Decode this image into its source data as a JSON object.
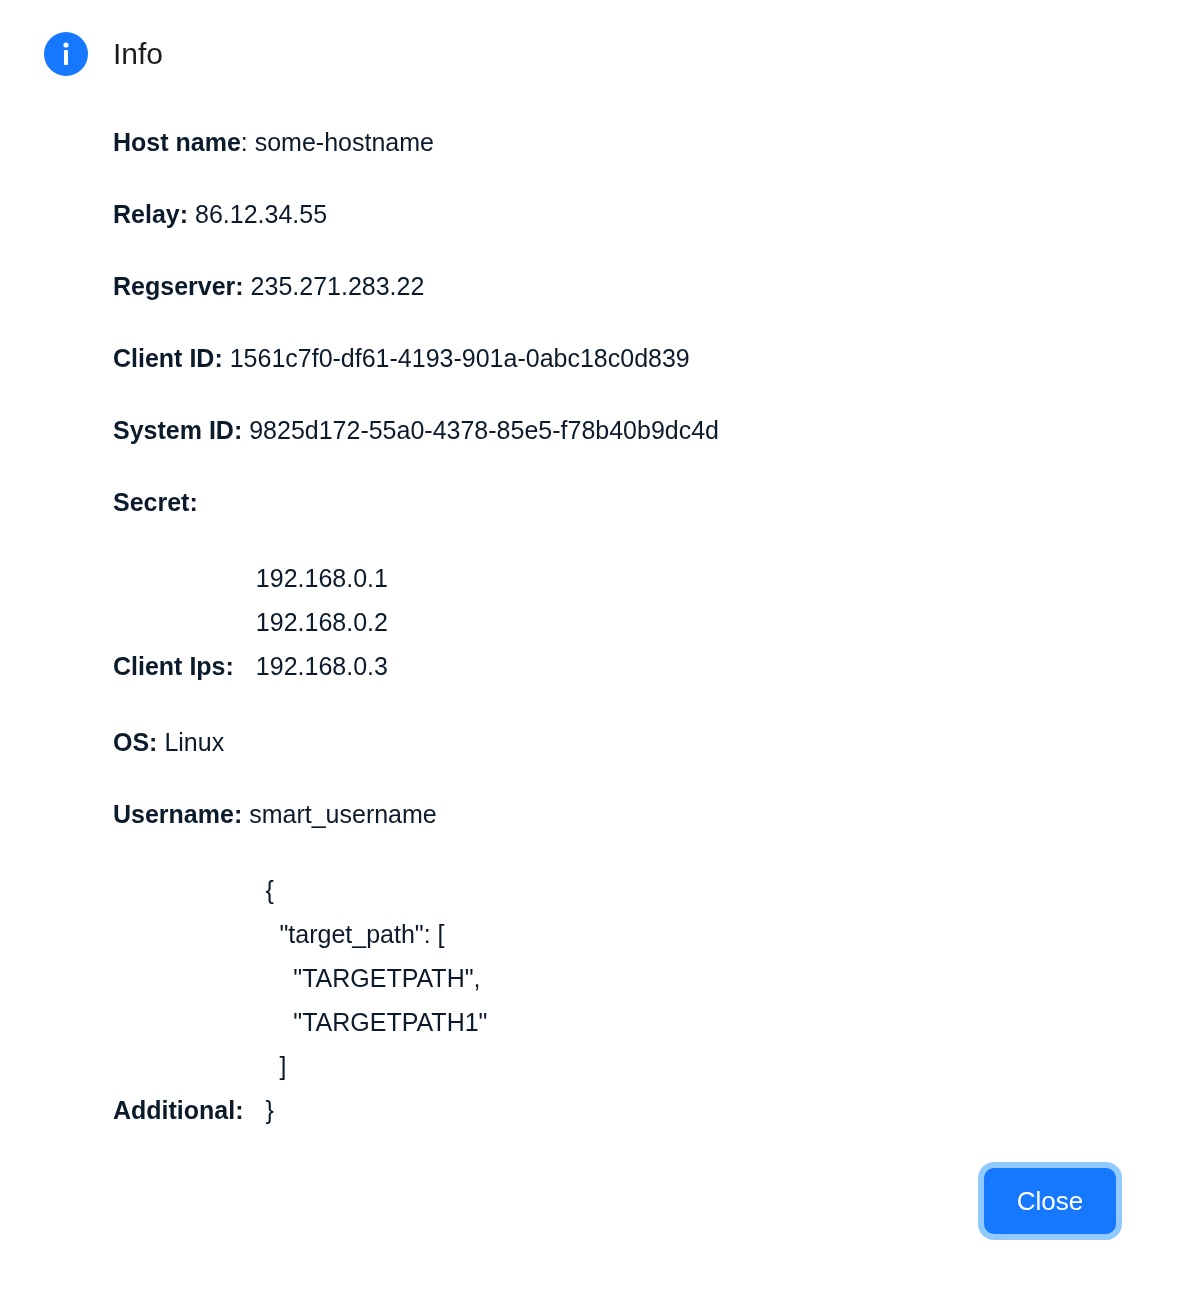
{
  "dialog": {
    "title": "Info",
    "rows": [
      {
        "kind": "text",
        "text": "**Host name**: some-hostname"
      },
      {
        "kind": "text",
        "text": "**Relay:** 86.12.34.55"
      },
      {
        "kind": "text",
        "text": "**Regserver:** 235.271.283.22"
      },
      {
        "kind": "text",
        "text": "**Client ID:** 1561c7f0-df61-4193-901a-0abc18c0d839"
      },
      {
        "kind": "text",
        "text": "**System ID:** 9825d172-55a0-4378-85e5-f78b40b9dc4d"
      },
      {
        "kind": "text",
        "text": "**Secret:**"
      },
      {
        "kind": "list",
        "label": "Client Ips:",
        "lines": [
          "192.168.0.1",
          "192.168.0.2",
          "192.168.0.3"
        ]
      },
      {
        "kind": "text",
        "text": "**OS:** Linux"
      },
      {
        "kind": "text",
        "text": "**Username:** smart_username"
      },
      {
        "kind": "code",
        "label": "Additional:",
        "code": "{\n  \"target_path\": [\n    \"TARGETPATH\",\n    \"TARGETPATH1\"\n  ]\n}"
      }
    ],
    "button": "Close"
  }
}
